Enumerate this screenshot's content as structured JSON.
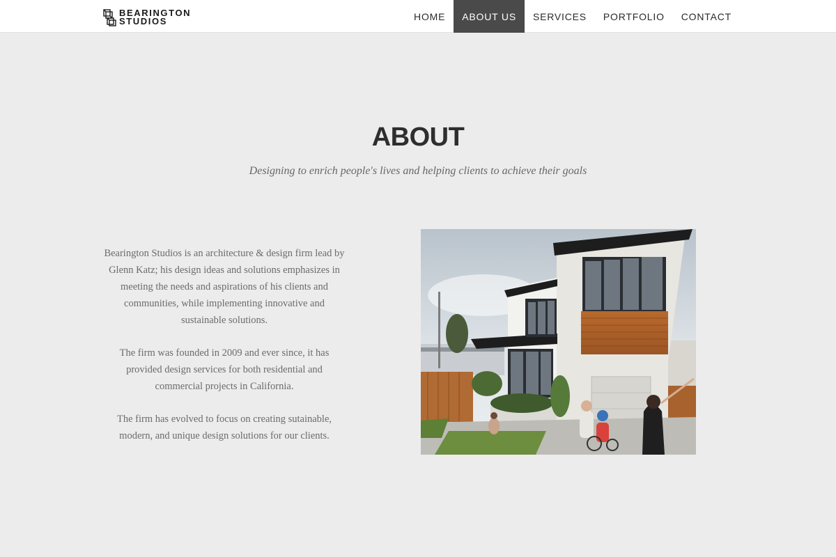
{
  "brand": {
    "logo_line1": "BEARINGTON",
    "logo_line2": "STUDIOS"
  },
  "nav": {
    "items": [
      {
        "label": "HOME",
        "active": false
      },
      {
        "label": "ABOUT US",
        "active": true
      },
      {
        "label": "SERVICES",
        "active": false
      },
      {
        "label": "PORTFOLIO",
        "active": false
      },
      {
        "label": "CONTACT",
        "active": false
      }
    ]
  },
  "about": {
    "title": "ABOUT",
    "tagline": "Designing to enrich people's lives and helping clients to achieve their goals",
    "paragraphs": [
      "Bearington Studios is an architecture & design firm lead by Glenn Katz; his design ideas and solutions emphasizes in meeting the needs and aspirations of his clients and communities, while implementing innovative and sustainable solutions.",
      "The firm was founded in 2009 and ever since, it has provided design services for both residential and commercial projects in California.",
      "The firm has evolved to focus on creating sutainable, modern, and unique design solutions for our clients."
    ],
    "image_subject": "modern-house-rendering"
  },
  "colors": {
    "page_bg": "#ececec",
    "nav_bg": "#ffffff",
    "nav_active_bg": "#4a4a4a",
    "title": "#2e2e2e",
    "body_text": "#6b6b6b"
  }
}
